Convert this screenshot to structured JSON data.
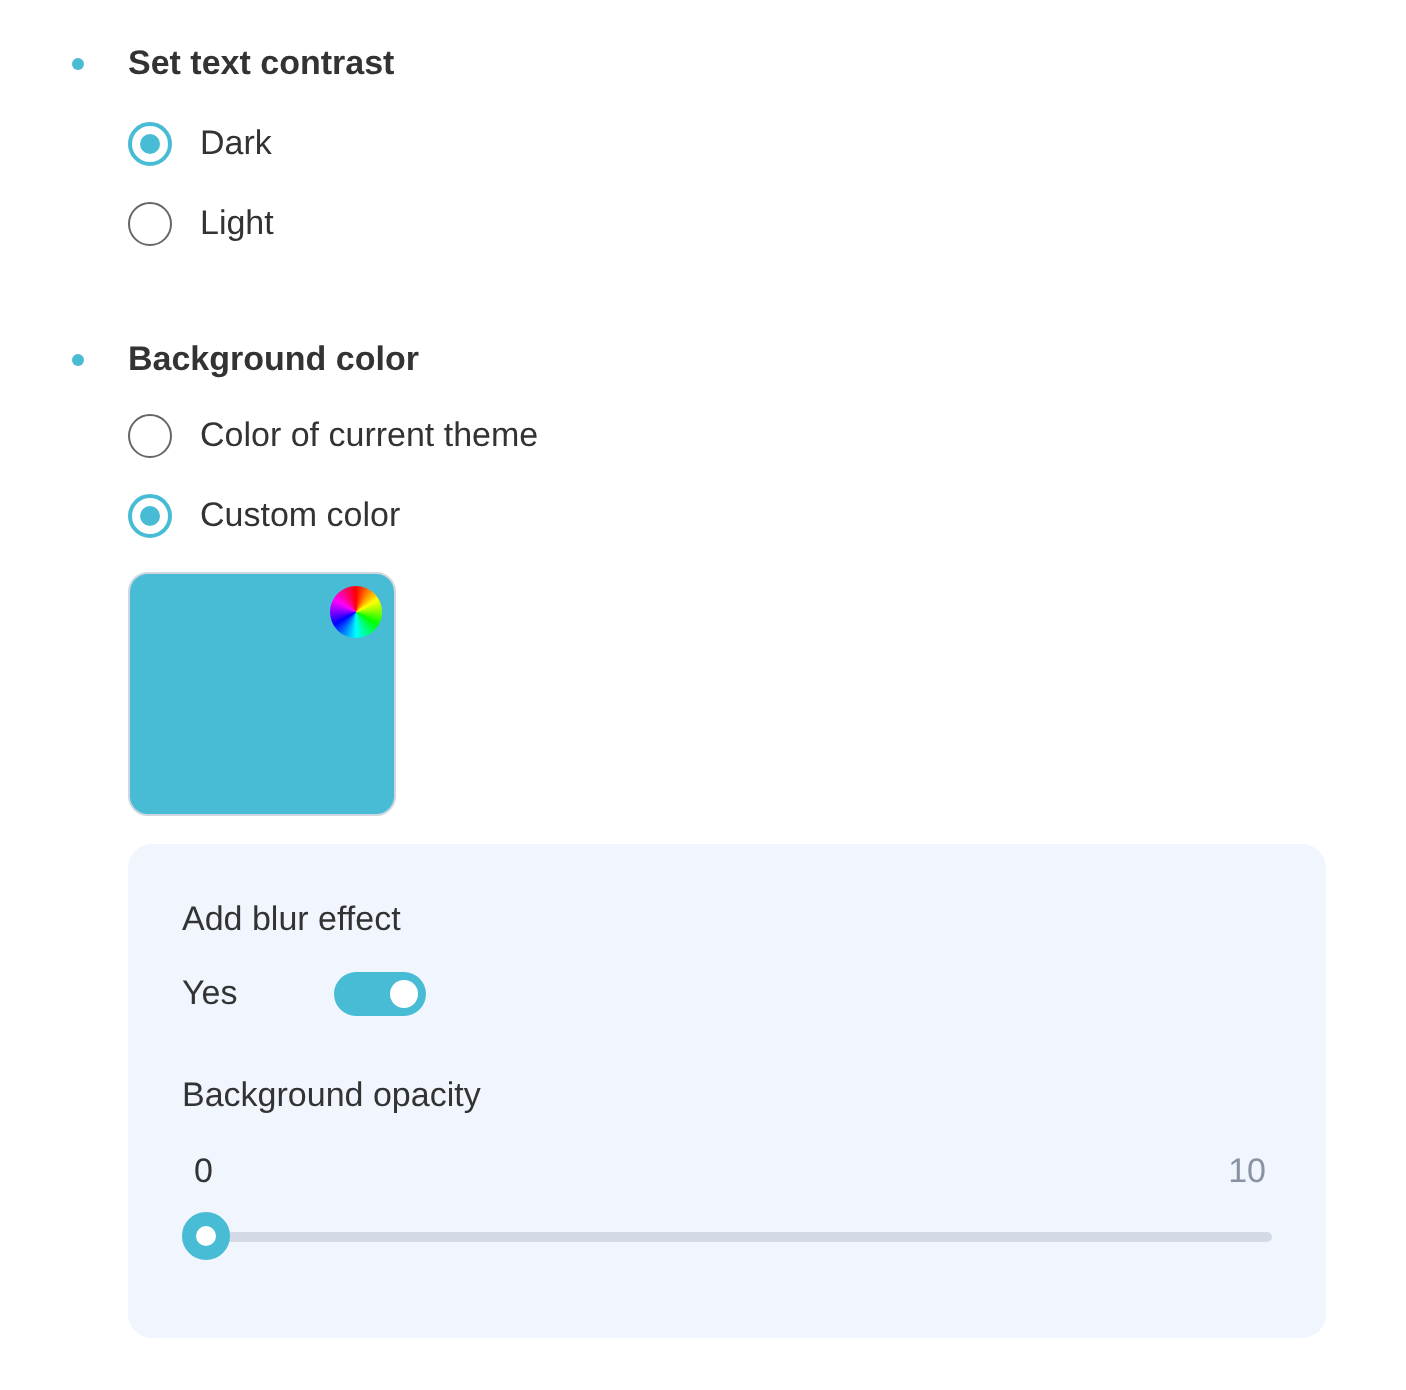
{
  "sections": [
    {
      "heading": "Set text contrast",
      "options": [
        {
          "label": "Dark",
          "selected": true
        },
        {
          "label": "Light",
          "selected": false
        }
      ]
    },
    {
      "heading": "Background color",
      "options": [
        {
          "label": "Color of current theme",
          "selected": false
        },
        {
          "label": "Custom color",
          "selected": true
        }
      ],
      "swatch": {
        "color": "#48bcd4"
      },
      "panel": {
        "blur_label": "Add blur effect",
        "toggle": {
          "label": "Yes",
          "on": true
        },
        "opacity": {
          "label": "Background opacity",
          "min": "0",
          "max": "10",
          "level": 0
        }
      }
    }
  ]
}
